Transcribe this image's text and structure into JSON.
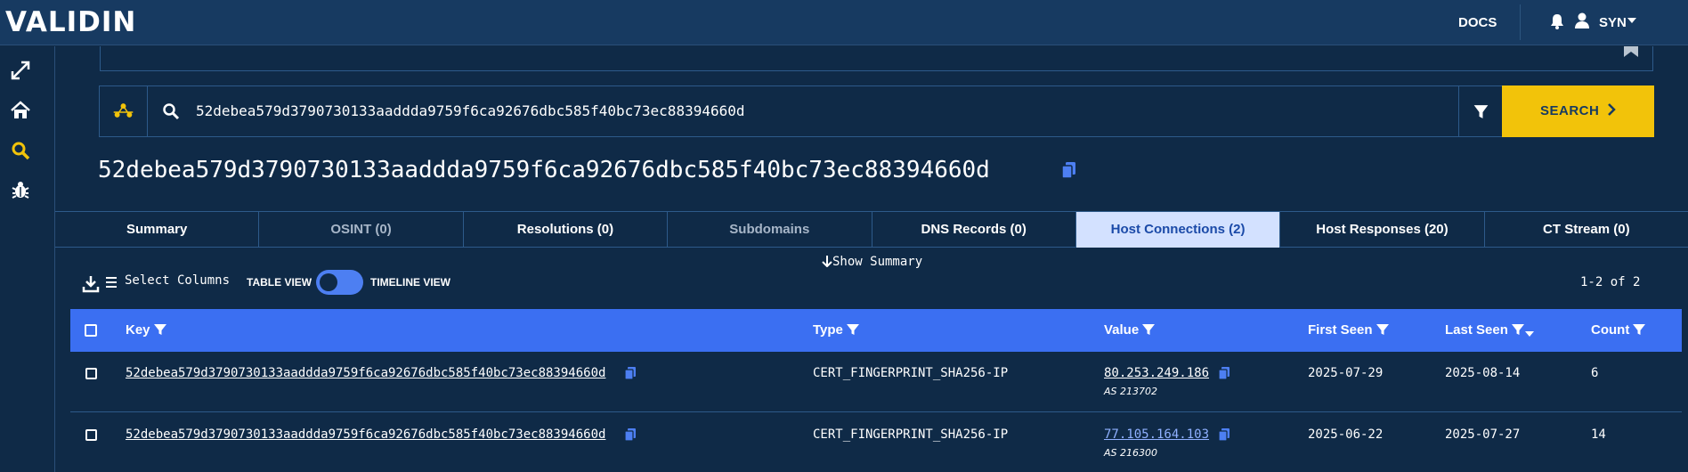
{
  "app": {
    "logo": "VALIDIN"
  },
  "header": {
    "docs": "DOCS",
    "user": "SYN"
  },
  "search": {
    "query": "52debea579d3790730133aaddda9759f6ca92676dbc585f40bc73ec88394660d",
    "button": "SEARCH"
  },
  "title": "52debea579d3790730133aaddda9759f6ca92676dbc585f40bc73ec88394660d",
  "tabs": [
    {
      "label": "Summary"
    },
    {
      "label": "OSINT (0)"
    },
    {
      "label": "Resolutions (0)"
    },
    {
      "label": "Subdomains"
    },
    {
      "label": "DNS Records (0)"
    },
    {
      "label": "Host Connections (2)"
    },
    {
      "label": "Host Responses (20)"
    },
    {
      "label": "CT Stream (0)"
    }
  ],
  "toolbar": {
    "show_summary": "Show Summary",
    "select_columns": "Select Columns",
    "table_view": "TABLE VIEW",
    "timeline_view": "TIMELINE VIEW",
    "pagination": "1-2 of 2"
  },
  "table": {
    "columns": [
      "Key",
      "Type",
      "Value",
      "First Seen",
      "Last Seen",
      "Count"
    ],
    "rows": [
      {
        "key": "52debea579d3790730133aaddda9759f6ca92676dbc585f40bc73ec88394660d",
        "type": "CERT_FINGERPRINT_SHA256-IP",
        "value": "80.253.249.186",
        "asn": "AS 213702",
        "first_seen": "2025-07-29",
        "last_seen": "2025-08-14",
        "count": "6"
      },
      {
        "key": "52debea579d3790730133aaddda9759f6ca92676dbc585f40bc73ec88394660d",
        "type": "CERT_FINGERPRINT_SHA256-IP",
        "value": "77.105.164.103",
        "asn": "AS 216300",
        "first_seen": "2025-06-22",
        "last_seen": "2025-07-27",
        "count": "14"
      }
    ]
  },
  "colors": {
    "background": "#0f2a47",
    "header": "#173a61",
    "accent_yellow": "#f2c30a",
    "table_header": "#3b6ff2",
    "active_tab": "#d3e1ff",
    "copy_icon": "#4d7ff2"
  }
}
